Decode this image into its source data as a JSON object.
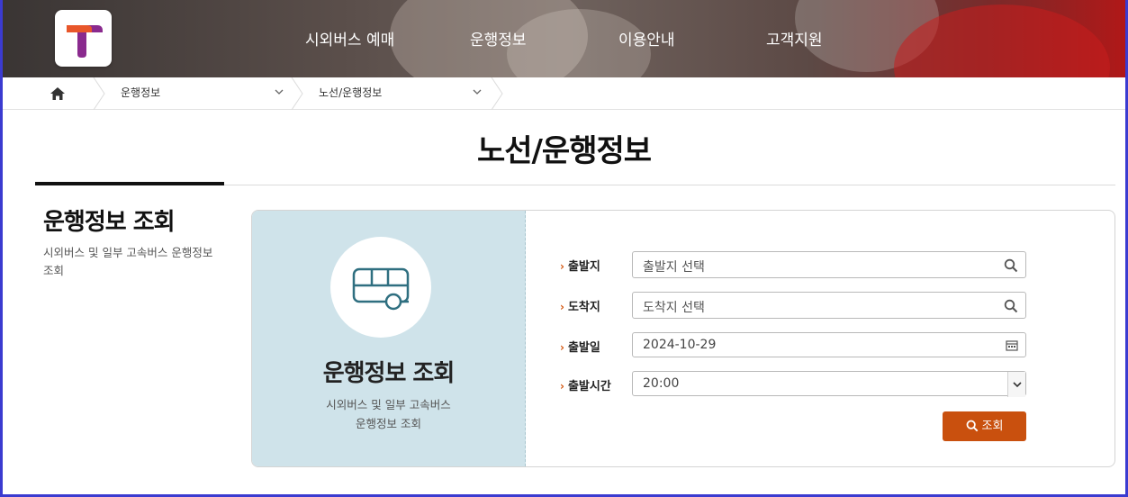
{
  "header": {
    "nav": [
      {
        "label": "시외버스 예매"
      },
      {
        "label": "운행정보"
      },
      {
        "label": "이용안내"
      },
      {
        "label": "고객지원"
      }
    ],
    "logo_color": "#8a2a8e",
    "logo_accent": "#e8562a"
  },
  "breadcrumb": {
    "home_icon": "home-icon",
    "items": [
      {
        "label": "운행정보"
      },
      {
        "label": "노선/운행정보"
      }
    ]
  },
  "page": {
    "title": "노선/운행정보"
  },
  "side": {
    "title": "운행정보 조회",
    "description": "시외버스 및 일부 고속버스 운행정보 조회"
  },
  "card": {
    "icon": "bus-icon",
    "title": "운행정보 조회",
    "description_line1": "시외버스 및 일부 고속버스",
    "description_line2": "운행정보 조회",
    "accent_bg": "#cfe3ea"
  },
  "form": {
    "departure": {
      "label": "출발지",
      "placeholder": "출발지 선택"
    },
    "arrival": {
      "label": "도착지",
      "placeholder": "도착지 선택"
    },
    "date": {
      "label": "출발일",
      "value": "2024-10-29"
    },
    "time": {
      "label": "출발시간",
      "value": "20:00"
    },
    "submit_label": "조회",
    "submit_color": "#c9500e"
  }
}
